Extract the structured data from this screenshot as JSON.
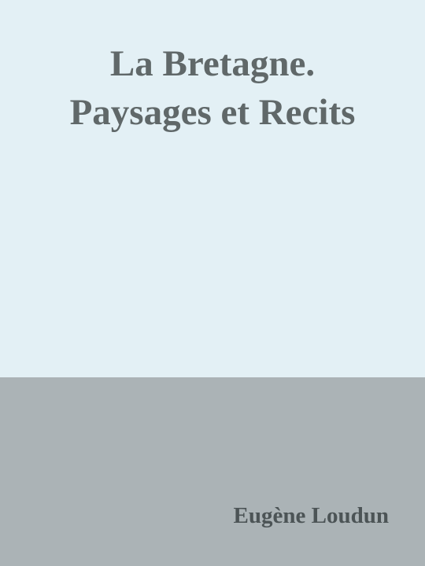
{
  "cover": {
    "title_lines": [
      "La Bretagne.",
      "Paysages et Recits"
    ],
    "author": "Eugène Loudun",
    "colors": {
      "top_background": "#e3f0f5",
      "bottom_background": "#abb3b6",
      "title_text": "#606869",
      "author_text": "#4c5456"
    }
  }
}
